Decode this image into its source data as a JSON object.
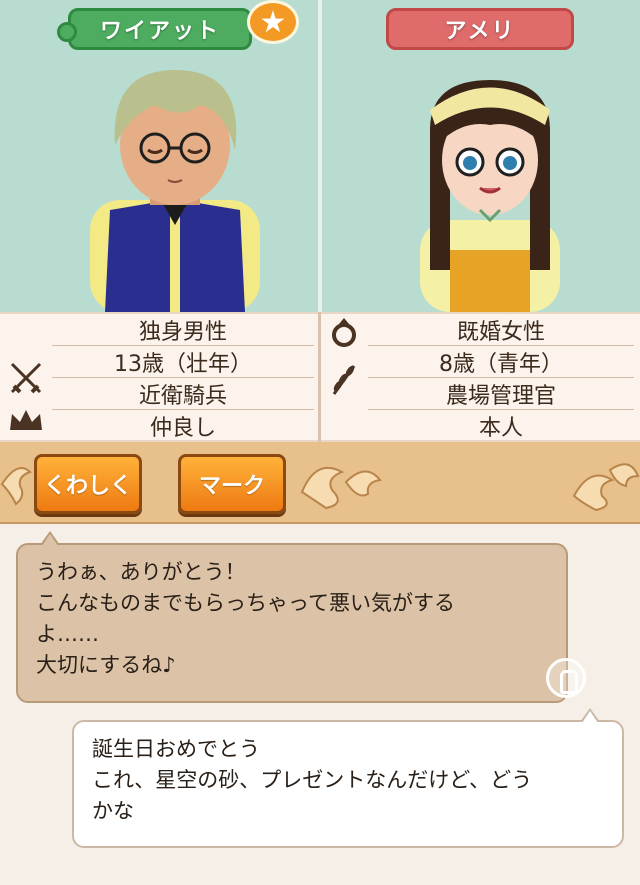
{
  "left_character": {
    "name": "ワイアット",
    "status": "独身男性",
    "age": "13歳（壮年）",
    "job": "近衛騎兵",
    "relation": "仲良し",
    "icons": [
      "crossed-swords-icon",
      "crown-icon"
    ]
  },
  "right_character": {
    "name": "アメリ",
    "status": "既婚女性",
    "age": "8歳（青年）",
    "job": "農場管理官",
    "relation": "本人",
    "icons": [
      "ring-icon",
      "wheat-icon"
    ]
  },
  "star_badge": "★",
  "buttons": {
    "detail": "くわしく",
    "mark": "マーク"
  },
  "dialogue": {
    "npc_lines": [
      "うわぁ、ありがとう！",
      "こんなものまでもらっちゃって悪い気がする",
      "よ……",
      "大切にするね♪"
    ],
    "player_lines": [
      "誕生日おめでとう",
      "これ、星空の砂、プレゼントなんだけど、どう",
      "かな"
    ]
  },
  "colors": {
    "portrait_bg": "#b8ddd0",
    "name_left": "#4dac5f",
    "name_right": "#df6b6b",
    "button": "#ee7a12",
    "bar": "#e8c08b"
  }
}
